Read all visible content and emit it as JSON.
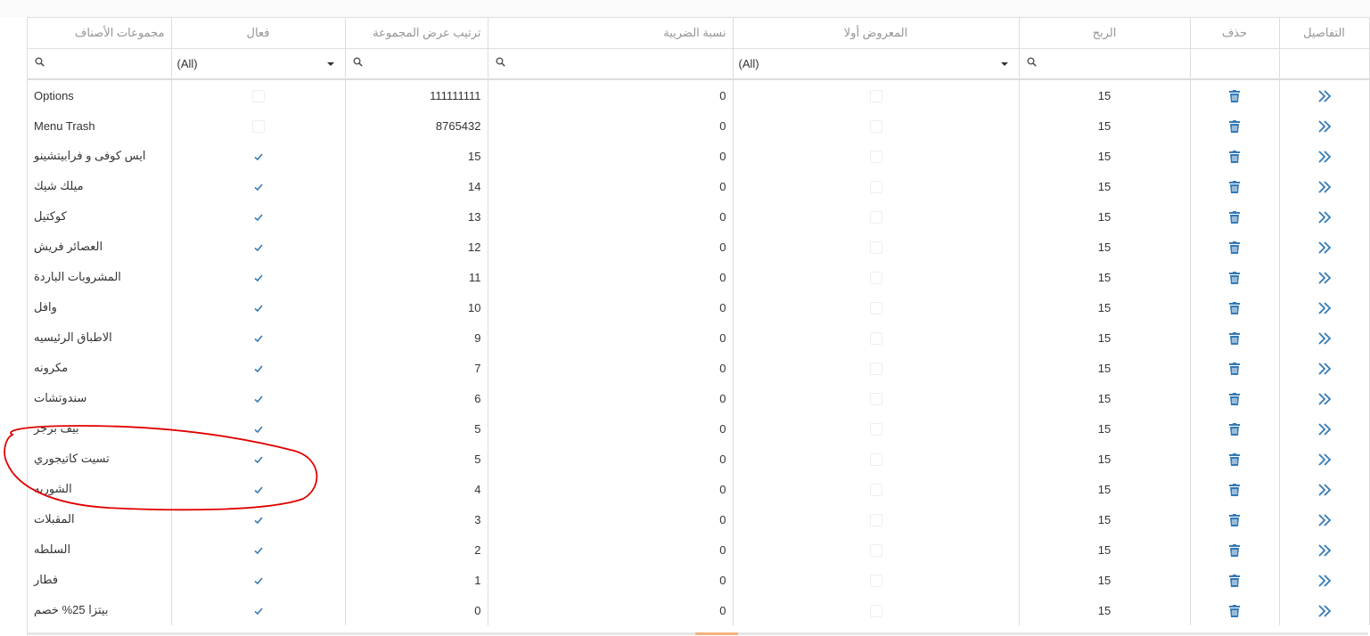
{
  "columns": {
    "groups": "مجموعات الأصناف",
    "active": "فعال",
    "order": "ترتيب عرض المجموعة",
    "tax": "نسبة الضريبة",
    "featured": "المعروض أولا",
    "profit": "الربح",
    "delete": "حذف",
    "details": "التفاصيل"
  },
  "filters": {
    "active_select": "(All)",
    "featured_select": "(All)"
  },
  "rows": [
    {
      "name": "Options",
      "active": false,
      "order": "111111111",
      "tax": "0",
      "featured": false,
      "profit": "15"
    },
    {
      "name": "Menu Trash",
      "active": false,
      "order": "8765432",
      "tax": "0",
      "featured": false,
      "profit": "15"
    },
    {
      "name": "ايس كوفى و فرابيتشينو",
      "active": true,
      "order": "15",
      "tax": "0",
      "featured": false,
      "profit": "15"
    },
    {
      "name": "ميلك شيك",
      "active": true,
      "order": "14",
      "tax": "0",
      "featured": false,
      "profit": "15"
    },
    {
      "name": "كوكتيل",
      "active": true,
      "order": "13",
      "tax": "0",
      "featured": false,
      "profit": "15"
    },
    {
      "name": "العصائر فريش",
      "active": true,
      "order": "12",
      "tax": "0",
      "featured": false,
      "profit": "15"
    },
    {
      "name": "المشروبات الباردة",
      "active": true,
      "order": "11",
      "tax": "0",
      "featured": false,
      "profit": "15"
    },
    {
      "name": "وافل",
      "active": true,
      "order": "10",
      "tax": "0",
      "featured": false,
      "profit": "15"
    },
    {
      "name": "الاطباق الرئيسيه",
      "active": true,
      "order": "9",
      "tax": "0",
      "featured": false,
      "profit": "15"
    },
    {
      "name": "مكرونه",
      "active": true,
      "order": "7",
      "tax": "0",
      "featured": false,
      "profit": "15"
    },
    {
      "name": "سندوتشات",
      "active": true,
      "order": "6",
      "tax": "0",
      "featured": false,
      "profit": "15"
    },
    {
      "name": "بيف برجر",
      "active": true,
      "order": "5",
      "tax": "0",
      "featured": false,
      "profit": "15"
    },
    {
      "name": "تسيت كاتيجوري",
      "active": true,
      "order": "5",
      "tax": "0",
      "featured": false,
      "profit": "15"
    },
    {
      "name": "الشوربه",
      "active": true,
      "order": "4",
      "tax": "0",
      "featured": false,
      "profit": "15"
    },
    {
      "name": "المقبلات",
      "active": true,
      "order": "3",
      "tax": "0",
      "featured": false,
      "profit": "15"
    },
    {
      "name": "السلطه",
      "active": true,
      "order": "2",
      "tax": "0",
      "featured": false,
      "profit": "15"
    },
    {
      "name": "فطار",
      "active": true,
      "order": "1",
      "tax": "0",
      "featured": false,
      "profit": "15"
    },
    {
      "name": "بيتزا 25% خصم",
      "active": true,
      "order": "0",
      "tax": "0",
      "featured": false,
      "profit": "15"
    }
  ],
  "colors": {
    "accent": "#337ab7",
    "annotation": "#e00000",
    "grid_line": "#dddddd",
    "header_text": "#959595"
  },
  "icons": {
    "filter": "search-icon",
    "delete": "trash-icon",
    "details": "double-chevron-right-icon",
    "checked": "checkmark-icon"
  }
}
